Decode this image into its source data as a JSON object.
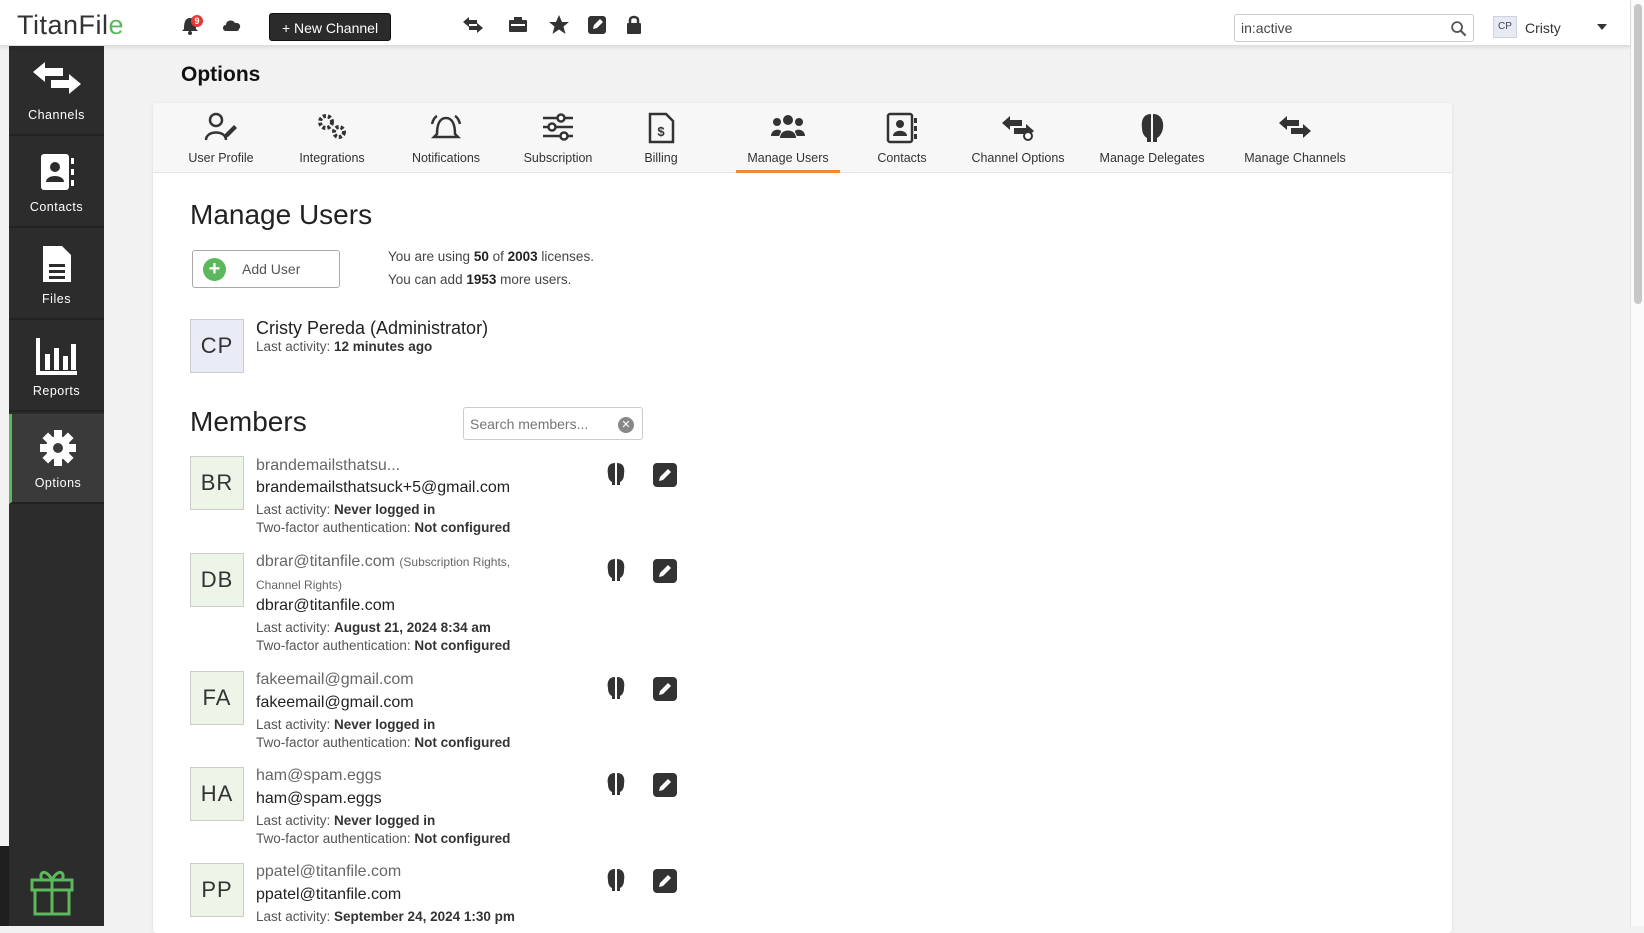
{
  "app": {
    "logo_main": "TitanFil",
    "logo_end": "e"
  },
  "topbar": {
    "notification_count": "9",
    "new_channel_label": "+ New Channel",
    "search_value": "in:active",
    "user_initials": "CP",
    "user_name": "Cristy"
  },
  "sidebar": {
    "items": [
      {
        "label": "Channels",
        "icon": "arrows-icon"
      },
      {
        "label": "Contacts",
        "icon": "contact-card-icon"
      },
      {
        "label": "Files",
        "icon": "file-icon"
      },
      {
        "label": "Reports",
        "icon": "bar-chart-icon"
      },
      {
        "label": "Options",
        "icon": "gear-icon"
      }
    ]
  },
  "page": {
    "title": "Options"
  },
  "tabs": [
    {
      "label": "User Profile"
    },
    {
      "label": "Integrations"
    },
    {
      "label": "Notifications"
    },
    {
      "label": "Subscription"
    },
    {
      "label": "Billing"
    },
    {
      "label": "Manage Users"
    },
    {
      "label": "Contacts"
    },
    {
      "label": "Channel Options"
    },
    {
      "label": "Manage Delegates"
    },
    {
      "label": "Manage Channels"
    }
  ],
  "manage_users": {
    "heading": "Manage Users",
    "add_user_label": "Add User",
    "lic_line1_pre": "You are using ",
    "lic_used": "50",
    "lic_of": " of ",
    "lic_total": "2003",
    "lic_line1_post": " licenses.",
    "lic_line2_pre": "You can add ",
    "lic_remaining": "1953",
    "lic_line2_post": " more users.",
    "admin": {
      "initials": "CP",
      "name": "Cristy Pereda (Administrator)",
      "activity_label": "Last activity: ",
      "activity_value": "12 minutes ago"
    }
  },
  "members": {
    "heading": "Members",
    "search_placeholder": "Search members...",
    "activity_label": "Last activity: ",
    "twofa_label": "Two-factor authentication: ",
    "list": [
      {
        "initials": "BR",
        "name": "brandemailsthatsu...",
        "rights": "",
        "rights2": "",
        "email": "brandemailsthatsuck+5@gmail.com",
        "activity": "Never logged in",
        "twofa": "Not configured"
      },
      {
        "initials": "DB",
        "name": "dbrar@titanfile.com",
        "rights": "(Subscription Rights,",
        "rights2": "Channel Rights)",
        "email": "dbrar@titanfile.com",
        "activity": "August 21, 2024 8:34 am",
        "twofa": "Not configured"
      },
      {
        "initials": "FA",
        "name": "fakeemail@gmail.com",
        "rights": "",
        "rights2": "",
        "email": "fakeemail@gmail.com",
        "activity": "Never logged in",
        "twofa": "Not configured"
      },
      {
        "initials": "HA",
        "name": "ham@spam.eggs",
        "rights": "",
        "rights2": "",
        "email": "ham@spam.eggs",
        "activity": "Never logged in",
        "twofa": "Not configured"
      },
      {
        "initials": "PP",
        "name": "ppatel@titanfile.com",
        "rights": "",
        "rights2": "",
        "email": "ppatel@titanfile.com",
        "activity": "September 24, 2024 1:30 pm",
        "twofa": "Not configured"
      }
    ]
  },
  "colors": {
    "accent_green": "#5cb85c",
    "active_tab": "#f0883a",
    "sidebar": "#2c2c2c"
  }
}
